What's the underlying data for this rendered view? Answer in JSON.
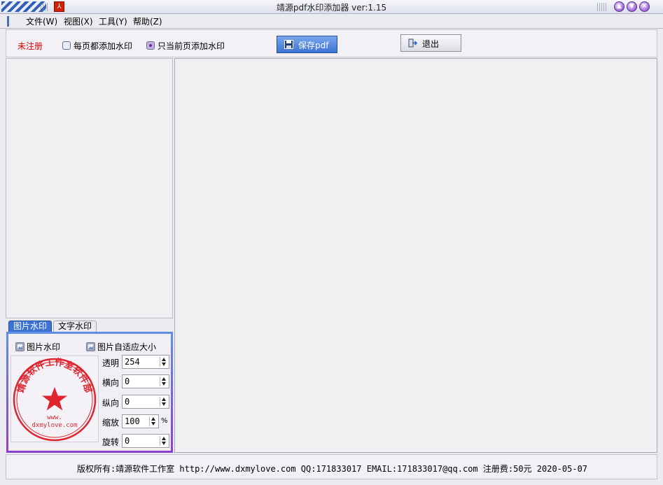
{
  "window": {
    "title": "靖源pdf水印添加器 ver:1.15",
    "app_icon_glyph": "⅄"
  },
  "menu": [
    {
      "label": "文件(W)"
    },
    {
      "label": "视图(X)"
    },
    {
      "label": "工具(Y)"
    },
    {
      "label": "帮助(Z)"
    }
  ],
  "toolbar": {
    "unregistered": "未注册",
    "option_every_page": "每页都添加水印",
    "option_current_page": "只当前页添加水印",
    "save_label": "保存pdf",
    "exit_label": "退出"
  },
  "tabs": [
    {
      "label": "图片水印"
    },
    {
      "label": "文字水印"
    }
  ],
  "watermark": {
    "image_watermark_label": "图片水印",
    "fit_size_label": "图片自适应大小",
    "stamp": {
      "line_top": "靖源软件工作室软件部",
      "line_mid": "www.",
      "line_bottom": "dxmylove.com"
    },
    "fields": [
      {
        "label": "透明",
        "value": "254"
      },
      {
        "label": "横向",
        "value": "0"
      },
      {
        "label": "纵向",
        "value": "0"
      },
      {
        "label": "缩放",
        "value": "100",
        "unit": "%"
      },
      {
        "label": "旋转",
        "value": "0"
      }
    ]
  },
  "status": "版权所有:靖源软件工作室 http://www.dxmylove.com QQ:171833017 EMAIL:171833017@qq.com 注册费:50元 2020-05-07",
  "colors": {
    "accent": "#3d73d4",
    "unregistered": "#e00000",
    "stamp": "#e0242e"
  }
}
